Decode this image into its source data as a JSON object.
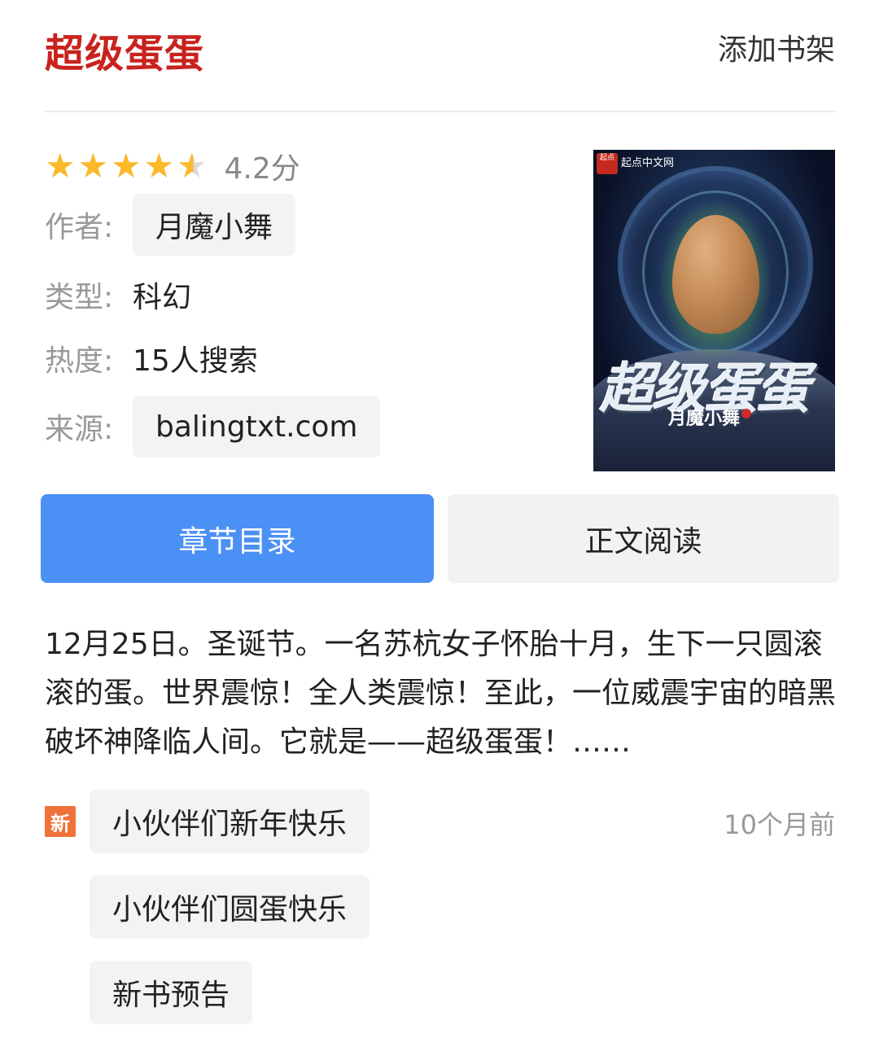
{
  "header": {
    "title": "超级蛋蛋",
    "add_to_shelf": "添加书架"
  },
  "rating": {
    "stars": 4.2,
    "max_stars": 5,
    "score_label": "4.2分"
  },
  "info": {
    "author_label": "作者:",
    "author": "月魔小舞",
    "genre_label": "类型:",
    "genre": "科幻",
    "heat_label": "热度:",
    "heat": "15人搜索",
    "source_label": "来源:",
    "source": "balingtxt.com"
  },
  "cover": {
    "brand": "起点中文网",
    "title": "超级蛋蛋",
    "author": "月魔小舞"
  },
  "buttons": {
    "toc": "章节目录",
    "read": "正文阅读"
  },
  "description": "12月25日。圣诞节。一名苏杭女子怀胎十月，生下一只圆滚滚的蛋。世界震惊！全人类震惊！至此，一位威震宇宙的暗黑破坏神降临人间。它就是——超级蛋蛋！……",
  "updates": {
    "badge": "新",
    "time": "10个月前",
    "chapters": [
      "小伙伴们新年快乐",
      "小伙伴们圆蛋快乐",
      "新书预告"
    ]
  },
  "colors": {
    "title_red": "#c9231e",
    "accent_blue": "#4b90f5",
    "star_gold": "#fbb829",
    "badge_orange": "#f0723a"
  }
}
